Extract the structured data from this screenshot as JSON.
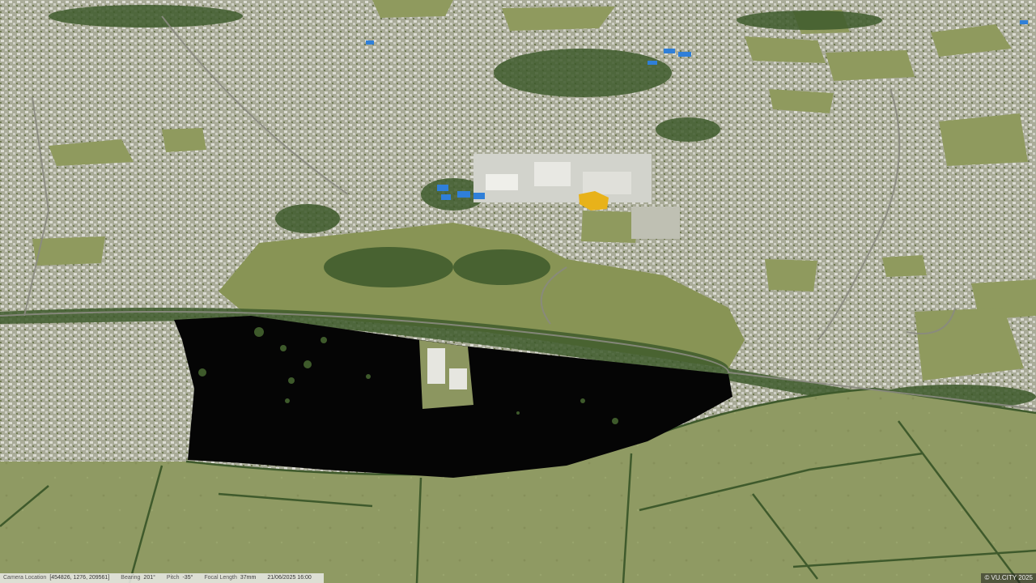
{
  "status": {
    "camera_location_label": "Camera Location",
    "camera_location_value": "[454826, 1276, 209561]",
    "bearing_label": "Bearing",
    "bearing_value": "201°",
    "pitch_label": "Pitch",
    "pitch_value": "-35°",
    "focal_length_label": "Focal Length",
    "focal_length_value": "37mm",
    "datetime": "21/06/2025 16:00"
  },
  "copyright": "© VU.CITY 2025",
  "colors": {
    "field": "#8f9a63",
    "urban": "#b9baaa",
    "trees": "#3f5a2c",
    "site_mask": "#050505",
    "highlight_yellow": "#e8b21a",
    "highlight_blue": "#2f7fd8"
  }
}
